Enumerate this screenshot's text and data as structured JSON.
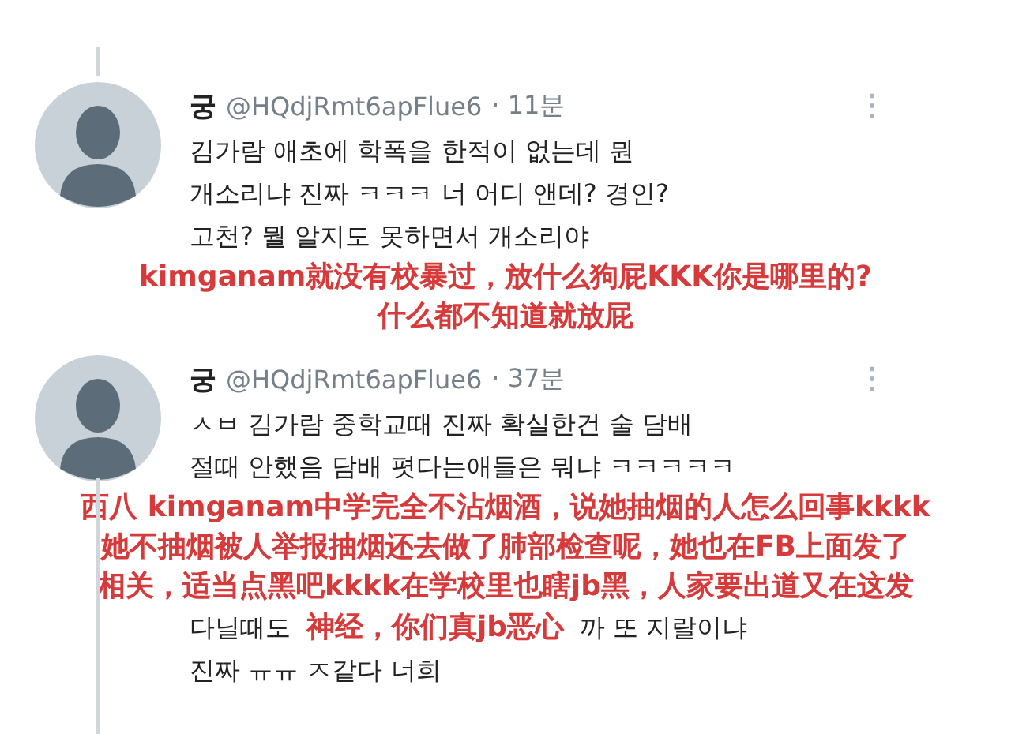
{
  "tweets": [
    {
      "author": "궁",
      "handle": "@HQdjRmt6apFlue6",
      "time": "· 11분",
      "body": [
        {
          "kind": "line",
          "text": "김가람 애초에 학폭을 한적이 없는데 뭔"
        },
        {
          "kind": "line",
          "text": "개소리냐 진짜 ㅋㅋㅋ 너 어디 앤데? 경인?"
        },
        {
          "kind": "line",
          "text": "고천? 뭘 알지도 못하면서 개소리야"
        },
        {
          "kind": "caption",
          "lines": [
            "kimganam就没有校暴过，放什么狗屁KKK你是哪里的?",
            "什么都不知道就放屁"
          ]
        }
      ]
    },
    {
      "author": "궁",
      "handle": "@HQdjRmt6apFlue6",
      "time": "· 37분",
      "body": [
        {
          "kind": "line",
          "text": "ㅅㅂ 김가람 중학교때 진짜 확실한건 술 담배"
        },
        {
          "kind": "line",
          "text": "절때 안했음 담배 폇다는애들은 뭐냐 ㅋㅋㅋㅋㅋ"
        },
        {
          "kind": "caption",
          "lines": [
            "西八 kimganam中学完全不沾烟酒，说她抽烟的人怎么回事kkkk",
            "她不抽烟被人举报抽烟还去做了肺部检查呢，她也在FB上面发了",
            "相关，适当点黑吧kkkk在学校里也瞎jb黑，人家要出道又在这发"
          ]
        },
        {
          "kind": "split",
          "left": "다닐때도",
          "caption": "神经，你们真jb恶心",
          "right": "까 또 지랄이냐"
        },
        {
          "kind": "line",
          "text": "진짜 ㅠㅠ ㅈ같다 너희"
        }
      ]
    }
  ]
}
